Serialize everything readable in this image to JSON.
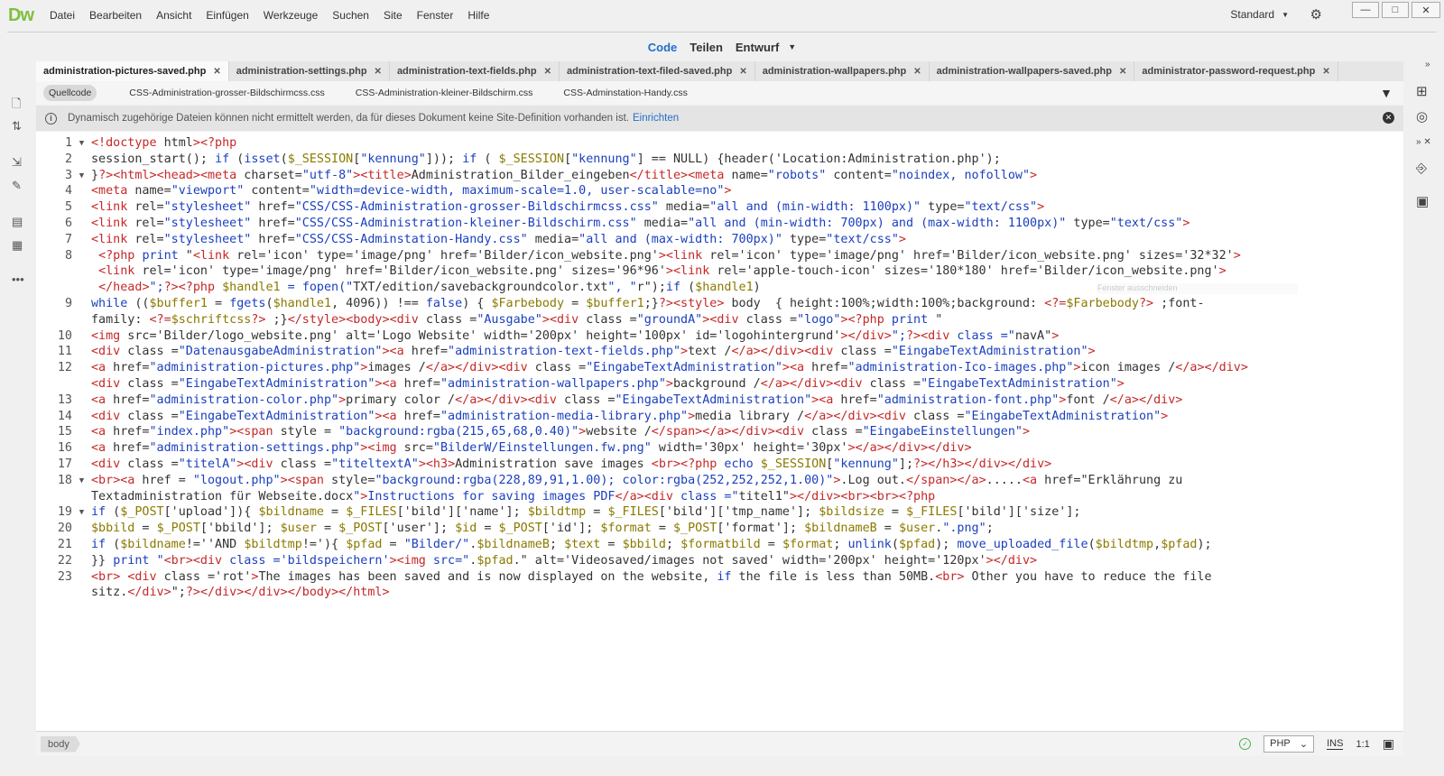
{
  "app": {
    "logo": "Dw"
  },
  "menu": [
    "Datei",
    "Bearbeiten",
    "Ansicht",
    "Einfügen",
    "Werkzeuge",
    "Suchen",
    "Site",
    "Fenster",
    "Hilfe"
  ],
  "workspace": {
    "label": "Standard"
  },
  "views": {
    "code": "Code",
    "split": "Teilen",
    "design": "Entwurf"
  },
  "tabs": [
    "administration-pictures-saved.php",
    "administration-settings.php",
    "administration-text-fields.php",
    "administration-text-filed-saved.php",
    "administration-wallpapers.php",
    "administration-wallpapers-saved.php",
    "administrator-password-request.php"
  ],
  "related_files": [
    "Quellcode",
    "CSS-Administration-grosser-Bildschirmcss.css",
    "CSS-Administration-kleiner-Bildschirm.css",
    "CSS-Adminstation-Handy.css"
  ],
  "info": {
    "text": "Dynamisch zugehörige Dateien können nicht ermittelt werden, da für dieses Dokument keine Site-Definition vorhanden ist.",
    "link": "Einrichten"
  },
  "tooltip": "Fenster ausschneiden",
  "code_lines": [
    {
      "n": "1",
      "fold": "▼",
      "text": "<!doctype html><?php"
    },
    {
      "n": "2",
      "fold": "",
      "text": "session_start(); if (isset($_SESSION[\"kennung\"])); if ( $_SESSION[\"kennung\"] == NULL) {header('Location:Administration.php');"
    },
    {
      "n": "3",
      "fold": "▼",
      "text": "}?><html><head><meta charset=\"utf-8\"><title>Administration_Bilder_eingeben</title><meta name=\"robots\" content=\"noindex, nofollow\">"
    },
    {
      "n": "4",
      "fold": "",
      "text": "<meta name=\"viewport\" content=\"width=device-width, maximum-scale=1.0, user-scalable=no\">"
    },
    {
      "n": "5",
      "fold": "",
      "text": "<link rel=\"stylesheet\" href=\"CSS/CSS-Administration-grosser-Bildschirmcss.css\" media=\"all and (min-width: 1100px)\" type=\"text/css\">"
    },
    {
      "n": "6",
      "fold": "",
      "text": "<link rel=\"stylesheet\" href=\"CSS/CSS-Administration-kleiner-Bildschirm.css\" media=\"all and (min-width: 700px) and (max-width: 1100px)\" type=\"text/css\">"
    },
    {
      "n": "7",
      "fold": "",
      "text": "<link rel=\"stylesheet\" href=\"CSS/CSS-Adminstation-Handy.css\" media=\"all and (max-width: 700px)\" type=\"text/css\">"
    },
    {
      "n": "8",
      "fold": "",
      "text": " <?php print \"<link rel='icon' type='image/png' href='Bilder/icon_website.png'><link rel='icon' type='image/png' href='Bilder/icon_website.png' sizes='32*32'>"
    },
    {
      "n": "",
      "fold": "",
      "text": " <link rel='icon' type='image/png' href='Bilder/icon_website.png' sizes='96*96'><link rel='apple-touch-icon' sizes='180*180' href='Bilder/icon_website.png'>"
    },
    {
      "n": "",
      "fold": "",
      "text": " </head>\";?><?php $handle1 = fopen(\"TXT/edition/savebackgroundcolor.txt\", \"r\");if ($handle1)"
    },
    {
      "n": "9",
      "fold": "",
      "text": "while (($buffer1 = fgets($handle1, 4096)) !== false) { $Farbebody = $buffer1;}?><style> body  { height:100%;width:100%;background: <?=$Farbebody?> ;font-"
    },
    {
      "n": "",
      "fold": "",
      "text": "family: <?=$schriftcss?> ;}</style><body><div class =\"Ausgabe\"><div class =\"groundA\"><div class =\"logo\"><?php print \""
    },
    {
      "n": "10",
      "fold": "",
      "text": "<img src='Bilder/logo_website.png' alt='Logo Website' width='200px' height='100px' id='logohintergrund'></div>\";?><div class =\"navA\">"
    },
    {
      "n": "11",
      "fold": "",
      "text": "<div class =\"DatenausgabeAdministration\"><a href=\"administration-text-fields.php\">text /</a></div><div class =\"EingabeTextAdministration\">"
    },
    {
      "n": "12",
      "fold": "",
      "text": "<a href=\"administration-pictures.php\">images /</a></div><div class =\"EingabeTextAdministration\"><a href=\"administration-Ico-images.php\">icon images /</a></div>"
    },
    {
      "n": "",
      "fold": "",
      "text": "<div class =\"EingabeTextAdministration\"><a href=\"administration-wallpapers.php\">background /</a></div><div class =\"EingabeTextAdministration\">"
    },
    {
      "n": "13",
      "fold": "",
      "text": "<a href=\"administration-color.php\">primary color /</a></div><div class =\"EingabeTextAdministration\"><a href=\"administration-font.php\">font /</a></div>"
    },
    {
      "n": "14",
      "fold": "",
      "text": "<div class =\"EingabeTextAdministration\"><a href=\"administration-media-library.php\">media library /</a></div><div class =\"EingabeTextAdministration\">"
    },
    {
      "n": "15",
      "fold": "",
      "text": "<a href=\"index.php\"><span style = \"background:rgba(215,65,68,0.40)\">website /</span></a></div><div class =\"EingabeEinstellungen\">"
    },
    {
      "n": "16",
      "fold": "",
      "text": "<a href=\"administration-settings.php\"><img src=\"BilderW/Einstellungen.fw.png\" width='30px' height='30px'></a></div></div>"
    },
    {
      "n": "17",
      "fold": "",
      "text": "<div class =\"titelA\"><div class =\"titeltextA\"><h3>Administration save images <br><?php echo $_SESSION[\"kennung\"];?></h3></div></div>"
    },
    {
      "n": "18",
      "fold": "▼",
      "text": "<br><a href = \"logout.php\"><span style=\"background:rgba(228,89,91,1.00); color:rgba(252,252,252,1.00)\">.Log out.</span></a>.....<a href=\"Erklährung zu"
    },
    {
      "n": "",
      "fold": "",
      "text": "Textadministration für Webseite.docx\">Instructions for saving images PDF</a><div class =\"titel1\"></div><br><br><?php"
    },
    {
      "n": "19",
      "fold": "▼",
      "text": "if ($_POST['upload']){ $bildname = $_FILES['bild']['name']; $bildtmp = $_FILES['bild']['tmp_name']; $bildsize = $_FILES['bild']['size'];"
    },
    {
      "n": "20",
      "fold": "",
      "text": "$bbild = $_POST['bbild']; $user = $_POST['user']; $id = $_POST['id']; $format = $_POST['format']; $bildnameB = $user.\".png\";"
    },
    {
      "n": "21",
      "fold": "",
      "text": "if ($bildname!=''AND $bildtmp!='){ $pfad = \"Bilder/\".$bildnameB; $text = $bbild; $formatbild = $format; unlink($pfad); move_uploaded_file($bildtmp,$pfad);"
    },
    {
      "n": "22",
      "fold": "",
      "text": "}} print \"<br><div class ='bildspeichern'><img src=\".$pfad.\" alt='Videosaved/images not saved' width='200px' height='120px'></div>"
    },
    {
      "n": "23",
      "fold": "",
      "text": "<br> <div class ='rot'>The images has been saved and is now displayed on the website, if the file is less than 50MB.<br> Other you have to reduce the file"
    },
    {
      "n": "",
      "fold": "",
      "text": "sitz.</div>\";?></div></div></body></html>"
    }
  ],
  "status": {
    "breadcrumb": "body",
    "language": "PHP",
    "mode": "INS",
    "position": "1:1"
  }
}
